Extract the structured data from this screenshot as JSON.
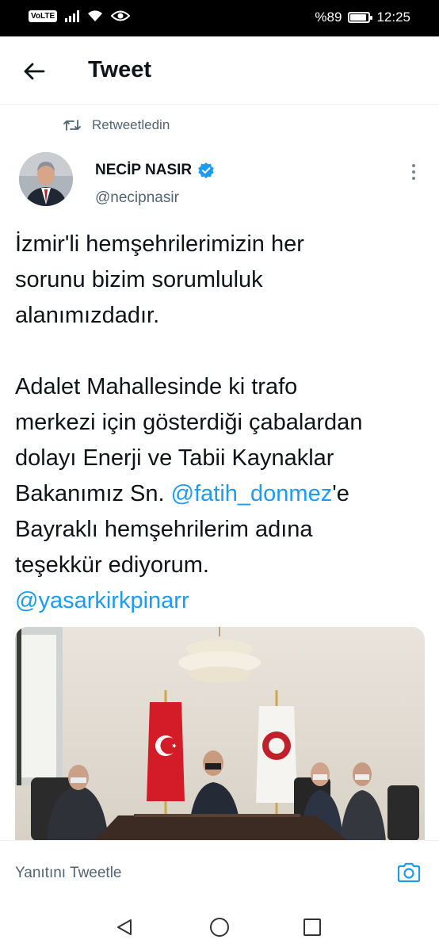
{
  "status_bar": {
    "volte": "VoLTE",
    "battery_text": "%89",
    "battery_level": 0.89,
    "time": "12:25",
    "icons": [
      "volte-icon",
      "signal-icon",
      "wifi-icon",
      "eye-comfort-icon",
      "battery-icon"
    ]
  },
  "header": {
    "back_icon": "arrow-left-icon",
    "title": "Tweet"
  },
  "retweet": {
    "icon": "retweet-icon",
    "label": "Retweetledin"
  },
  "author": {
    "name": "NECİP NASIR",
    "verified": true,
    "handle": "@necipnasir"
  },
  "tweet": {
    "paragraph1": [
      "İzmir'li hemşehrilerimizin her",
      "sorunu bizim sorumluluk",
      "alanımızdadır."
    ],
    "paragraph2": {
      "line1": "Adalet Mahallesinde ki trafo",
      "line2": "merkezi için gösterdiği çabalardan",
      "line3": "dolayı Enerji ve Tabii Kaynaklar",
      "line4_before": "Bakanımız Sn. ",
      "line4_mention": "@fatih_donmez",
      "line4_after": "'e",
      "line5": "Bayraklı hemşehrilerim adına",
      "line6": "teşekkür ediyorum."
    },
    "mention_last": "@yasarkirkpinarr"
  },
  "reply_bar": {
    "placeholder": "Yanıtını Tweetle",
    "camera_icon": "camera-icon"
  },
  "nav_bar": {
    "icons": [
      "back-triangle-icon",
      "home-circle-icon",
      "recents-square-icon"
    ]
  },
  "colors": {
    "accent": "#1d9bf0",
    "text": "#0f1419",
    "secondary": "#536471"
  }
}
